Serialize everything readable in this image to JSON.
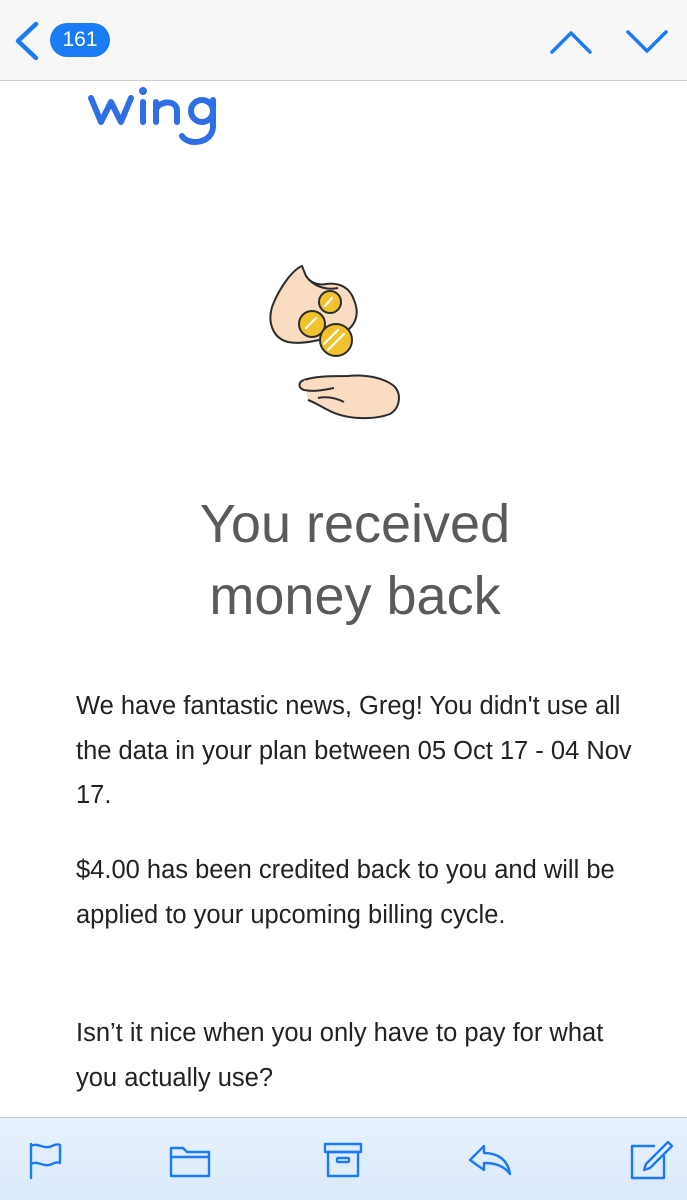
{
  "nav": {
    "back_icon": "chevron-left-icon",
    "unread_count": "161",
    "prev_icon": "chevron-up-icon",
    "next_icon": "chevron-down-icon"
  },
  "email": {
    "brand_logo": "wing",
    "headline_line1": "You received",
    "headline_line2": "money back",
    "paragraph1": "We have fantastic news, Greg! You didn't use all the data in your plan between 05 Oct 17 - 04 Nov 17.",
    "paragraph2": "$4.00 has been credited back to you and will be applied to your upcoming billing cycle.",
    "paragraph3": "Isn’t it nice when you only have to pay for what you actually use?"
  },
  "toolbar": {
    "icons": [
      "flag-icon",
      "folder-icon",
      "archive-icon",
      "reply-icon",
      "compose-icon"
    ]
  },
  "colors": {
    "accent": "#1a7cf5",
    "brand": "#2f6fe4",
    "coin": "#f2c12e",
    "hand": "#f9dcc1",
    "headline": "#5a5a5a"
  }
}
